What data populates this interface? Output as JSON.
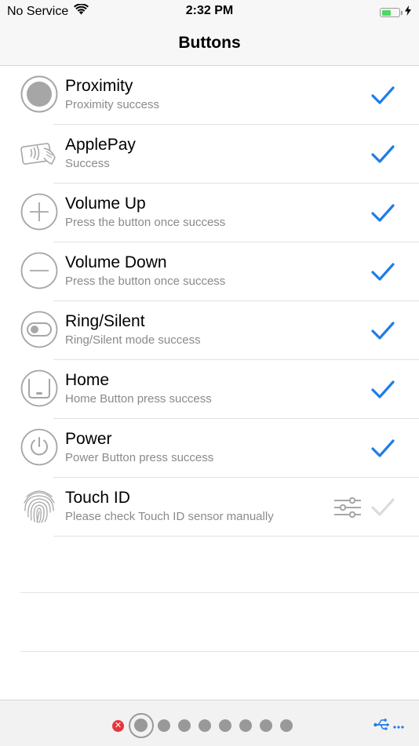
{
  "status_bar": {
    "carrier": "No Service",
    "time": "2:32 PM",
    "icons": [
      "wifi-icon",
      "battery-icon",
      "charging-bolt-icon"
    ],
    "battery_color": "#4cd964"
  },
  "nav": {
    "title": "Buttons"
  },
  "tests": [
    {
      "title": "Proximity",
      "subtitle": "Proximity success",
      "icon": "proximity-icon",
      "passed": true
    },
    {
      "title": "ApplePay",
      "subtitle": "Success",
      "icon": "contactless-pay-icon",
      "passed": true
    },
    {
      "title": "Volume Up",
      "subtitle": "Press the button once success",
      "icon": "plus-circle-icon",
      "passed": true
    },
    {
      "title": "Volume Down",
      "subtitle": "Press the button once success",
      "icon": "minus-circle-icon",
      "passed": true
    },
    {
      "title": "Ring/Silent",
      "subtitle": "Ring/Silent mode success",
      "icon": "toggle-switch-icon",
      "passed": true
    },
    {
      "title": "Home",
      "subtitle": "Home Button press success",
      "icon": "home-button-icon",
      "passed": true
    },
    {
      "title": "Power",
      "subtitle": "Power Button press success",
      "icon": "power-icon",
      "passed": true
    },
    {
      "title": "Touch ID",
      "subtitle": "Please check Touch ID sensor manually",
      "icon": "fingerprint-icon",
      "passed": false
    }
  ],
  "colors": {
    "check_active": "#1f7ce6",
    "check_inactive": "#dcdcdc",
    "icon_gray": "#a6a6a6",
    "error_red": "#e8353a"
  },
  "pager": {
    "total_pages": 9,
    "current_page": 2,
    "error_page": 1
  },
  "footer": {
    "icon": "usb-icon"
  }
}
